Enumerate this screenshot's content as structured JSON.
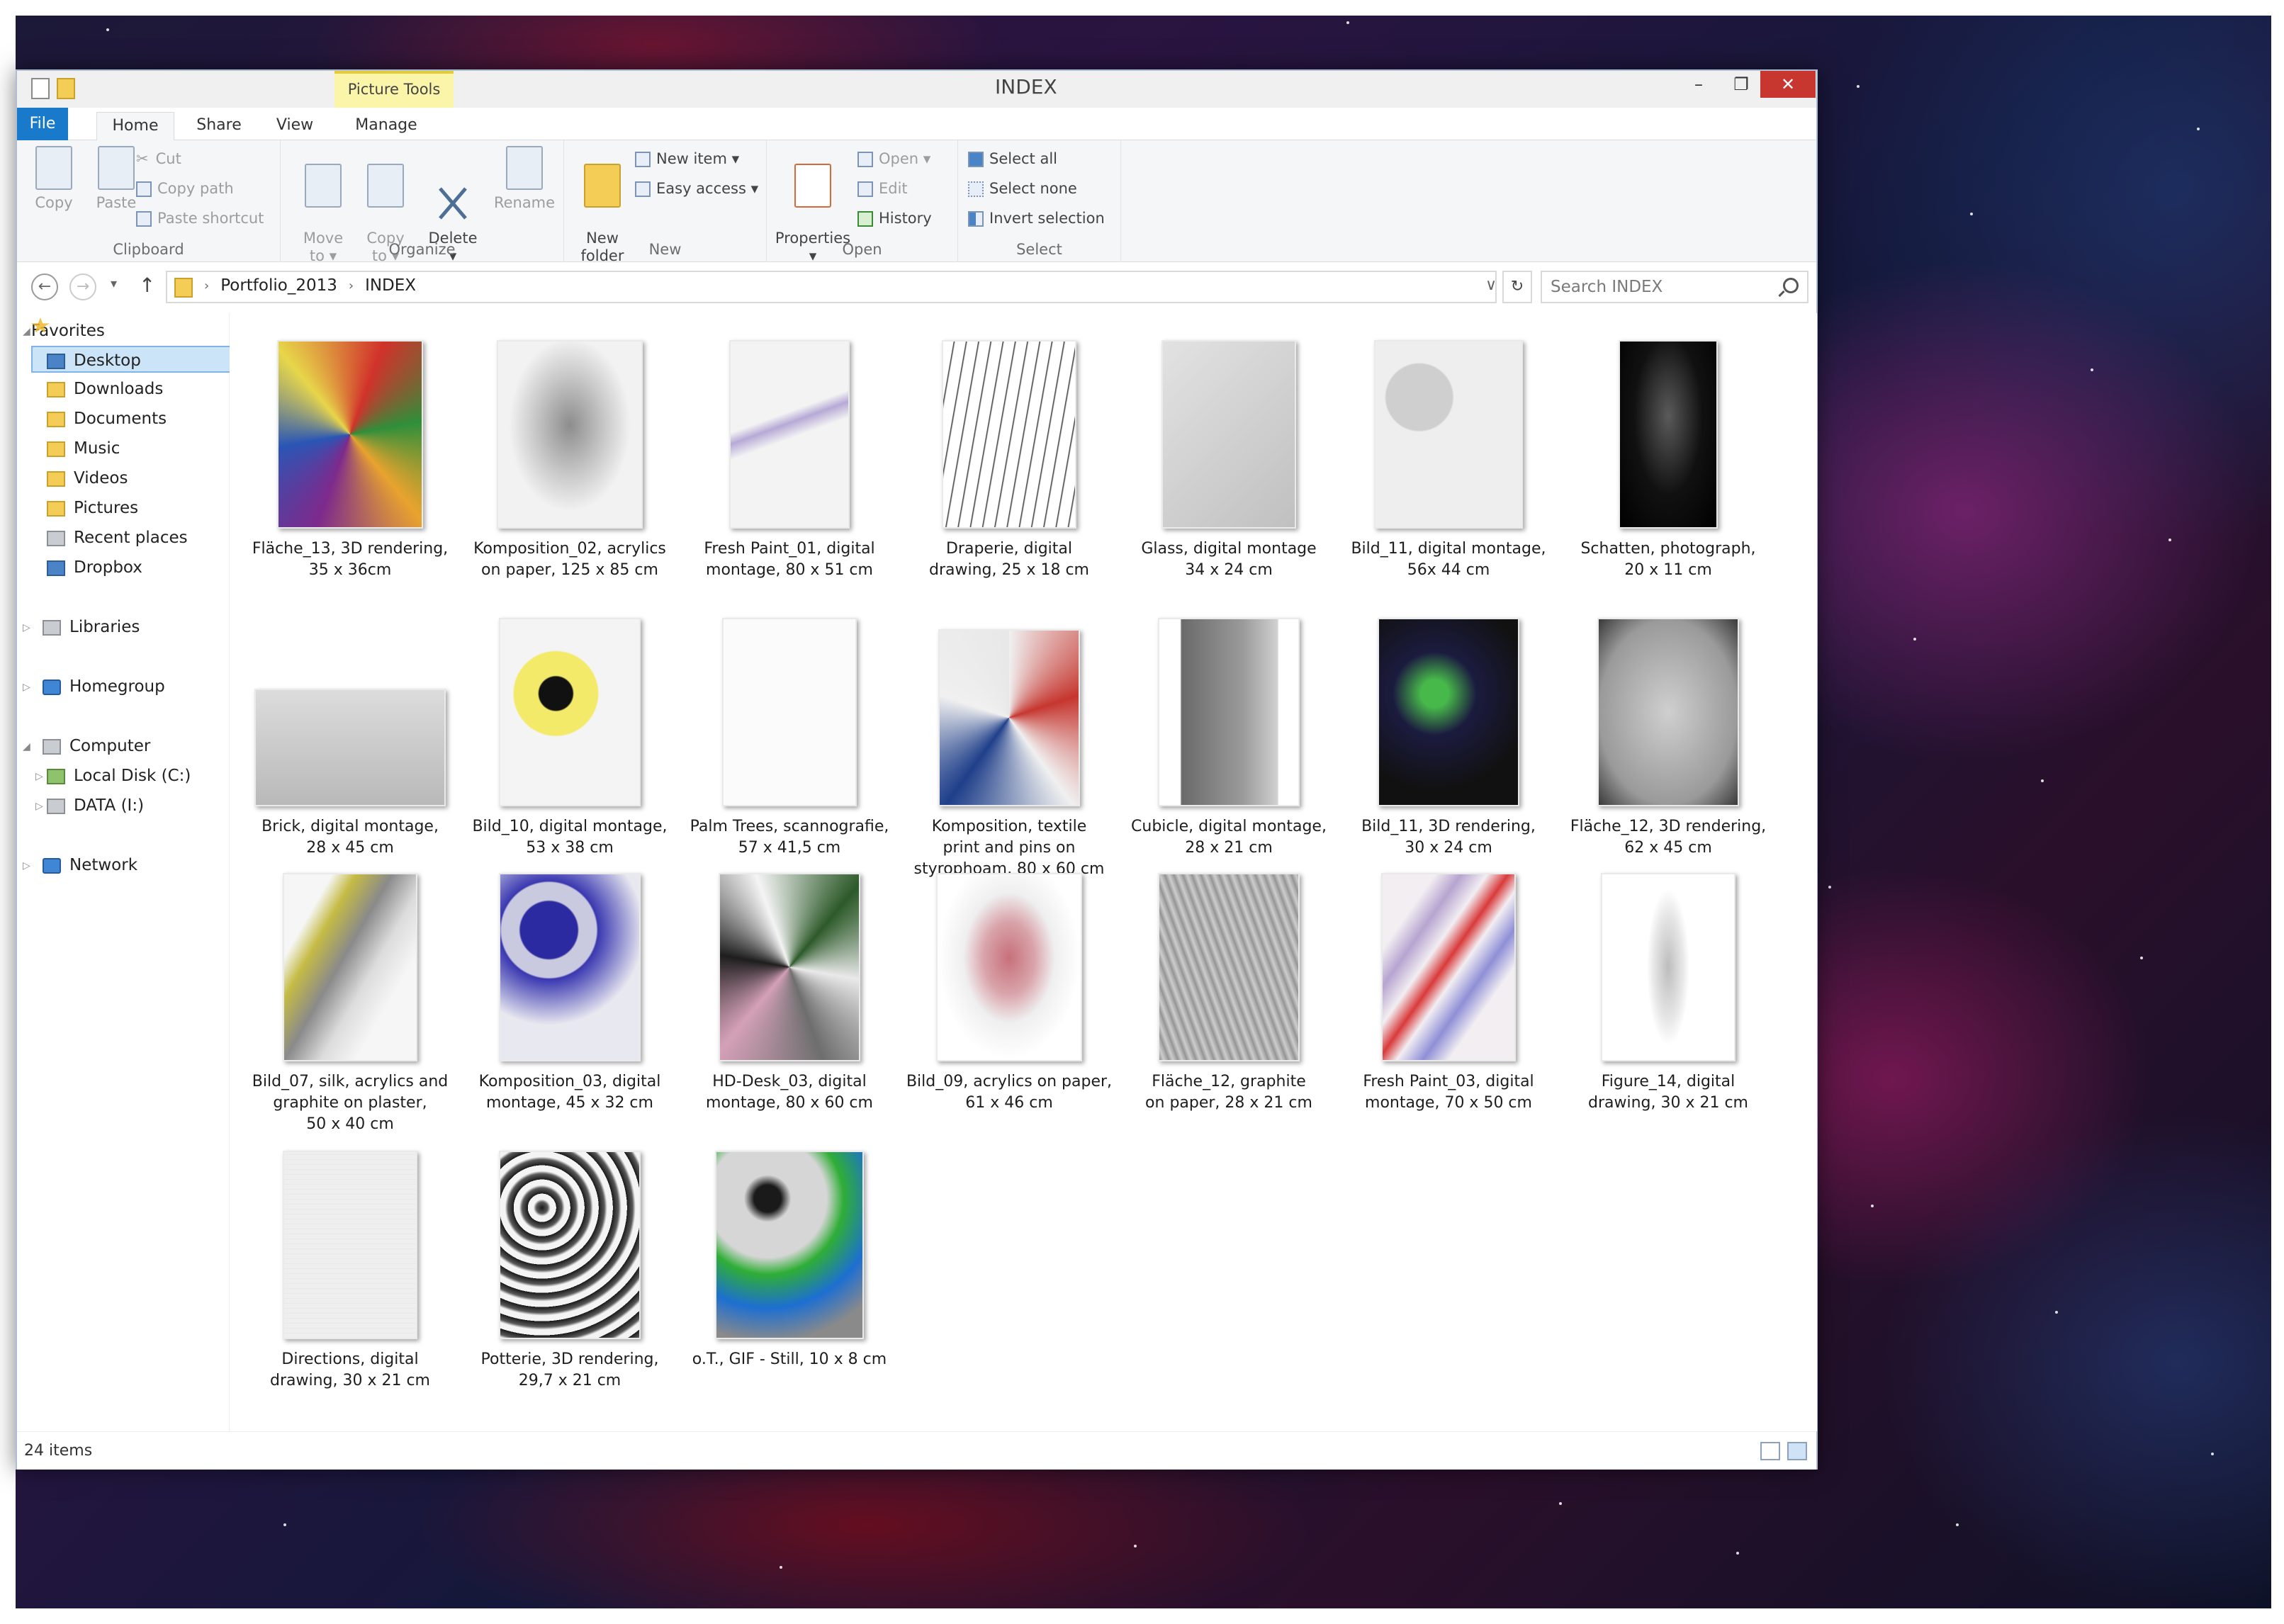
{
  "window": {
    "title": "INDEX",
    "contextual_tab": "Picture Tools",
    "minimize": "–",
    "restore": "❐",
    "close": "✕"
  },
  "ribbon": {
    "tabs": {
      "file": "File",
      "home": "Home",
      "share": "Share",
      "view": "View",
      "manage": "Manage"
    },
    "clipboard": {
      "copy": "Copy",
      "paste": "Paste",
      "cut": "Cut",
      "copy_path": "Copy path",
      "paste_shortcut": "Paste shortcut",
      "label": "Clipboard"
    },
    "organize": {
      "move_to": "Move\nto ▾",
      "copy_to": "Copy\nto ▾",
      "delete": "Delete\n▾",
      "rename": "Rename",
      "label": "Organize"
    },
    "new": {
      "new_folder": "New\nfolder",
      "new_item": "New item ▾",
      "easy_access": "Easy access ▾",
      "label": "New"
    },
    "open": {
      "properties": "Properties\n▾",
      "open": "Open ▾",
      "edit": "Edit",
      "history": "History",
      "label": "Open"
    },
    "select": {
      "select_all": "Select all",
      "select_none": "Select none",
      "invert": "Invert selection",
      "label": "Select"
    }
  },
  "address": {
    "crumbs": [
      "Portfolio_2013",
      "INDEX"
    ],
    "search_placeholder": "Search INDEX"
  },
  "nav": {
    "favorites": "Favorites",
    "desktop": "Desktop",
    "downloads": "Downloads",
    "documents": "Documents",
    "music": "Music",
    "videos": "Videos",
    "pictures": "Pictures",
    "recent": "Recent places",
    "dropbox": "Dropbox",
    "libraries": "Libraries",
    "homegroup": "Homegroup",
    "computer": "Computer",
    "local_disk": "Local Disk (C:)",
    "data": "DATA (I:)",
    "network": "Network"
  },
  "files": [
    {
      "caption": "Fläche_13, 3D rendering,\n35 x 36cm"
    },
    {
      "caption": "Komposition_02, acrylics\non paper, 125 x 85 cm"
    },
    {
      "caption": "Fresh Paint_01, digital\nmontage, 80 x 51 cm"
    },
    {
      "caption": "Draperie, digital\ndrawing, 25 x 18 cm"
    },
    {
      "caption": "Glass, digital montage\n34 x 24 cm"
    },
    {
      "caption": "Bild_11, digital montage,\n56x 44 cm"
    },
    {
      "caption": "Schatten, photograph,\n20 x 11 cm"
    },
    {
      "caption": "Brick, digital montage,\n28 x 45 cm"
    },
    {
      "caption": "Bild_10, digital montage,\n53 x 38 cm"
    },
    {
      "caption": "Palm Trees, scannografie,\n57 x 41,5 cm"
    },
    {
      "caption": "Komposition, textile\nprint and pins on\nstyrophoam, 80 x 60 cm"
    },
    {
      "caption": "Cubicle, digital montage,\n28 x 21 cm"
    },
    {
      "caption": "Bild_11, 3D rendering,\n30 x 24 cm"
    },
    {
      "caption": "Fläche_12, 3D rendering,\n62 x 45 cm"
    },
    {
      "caption": "Bild_07, silk, acrylics and\ngraphite on plaster,\n50 x 40 cm"
    },
    {
      "caption": "Komposition_03, digital\nmontage, 45 x 32 cm"
    },
    {
      "caption": "HD-Desk_03, digital\nmontage, 80 x 60 cm"
    },
    {
      "caption": "Bild_09, acrylics on paper,\n61 x 46 cm"
    },
    {
      "caption": "Fläche_12, graphite\non paper, 28 x 21 cm"
    },
    {
      "caption": "Fresh Paint_03, digital\nmontage, 70 x 50 cm"
    },
    {
      "caption": "Figure_14, digital\ndrawing, 30 x 21 cm"
    },
    {
      "caption": "Directions, digital\ndrawing, 30 x 21 cm"
    },
    {
      "caption": "Potterie, 3D rendering,\n29,7 x 21 cm"
    },
    {
      "caption": "o.T., GIF - Still, 10 x 8 cm"
    }
  ],
  "status": {
    "item_count": "24 items"
  }
}
